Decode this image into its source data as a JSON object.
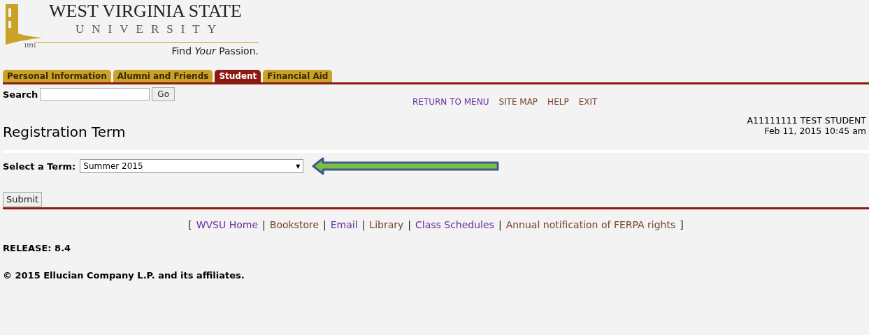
{
  "logo": {
    "name": "WEST VIRGINIA STATE",
    "sub": "UNIVERSITY",
    "year": "1891",
    "tagline": "Find *Your* Passion."
  },
  "tabs": [
    {
      "label": "Personal Information",
      "selected": false
    },
    {
      "label": "Alumni and Friends",
      "selected": false
    },
    {
      "label": "Student",
      "selected": true
    },
    {
      "label": "Financial Aid",
      "selected": false
    }
  ],
  "search": {
    "label": "Search",
    "button": "Go"
  },
  "top_links": [
    {
      "label": "RETURN TO MENU",
      "visited": true
    },
    {
      "label": "SITE MAP",
      "visited": false
    },
    {
      "label": "HELP",
      "visited": false
    },
    {
      "label": "EXIT",
      "visited": false
    }
  ],
  "page_title": "Registration Term",
  "user": {
    "id_name": "A11111111 TEST STUDENT",
    "datetime": "Feb 11, 2015 10:45 am"
  },
  "term": {
    "label": "Select a Term:",
    "value": "Summer 2015",
    "caret": "▼"
  },
  "submit": "Submit",
  "footer_links": [
    {
      "label": "WVSU Home",
      "visited": true
    },
    {
      "label": "Bookstore",
      "visited": false
    },
    {
      "label": "Email",
      "visited": true
    },
    {
      "label": "Library",
      "visited": false
    },
    {
      "label": "Class Schedules",
      "visited": true
    },
    {
      "label": "Annual notification of FERPA rights",
      "visited": false
    }
  ],
  "bracket_open": "[",
  "bracket_close": "]",
  "separator": "|",
  "release": "RELEASE: 8.4",
  "copyright": "© 2015 Ellucian Company L.P. and its affiliates."
}
